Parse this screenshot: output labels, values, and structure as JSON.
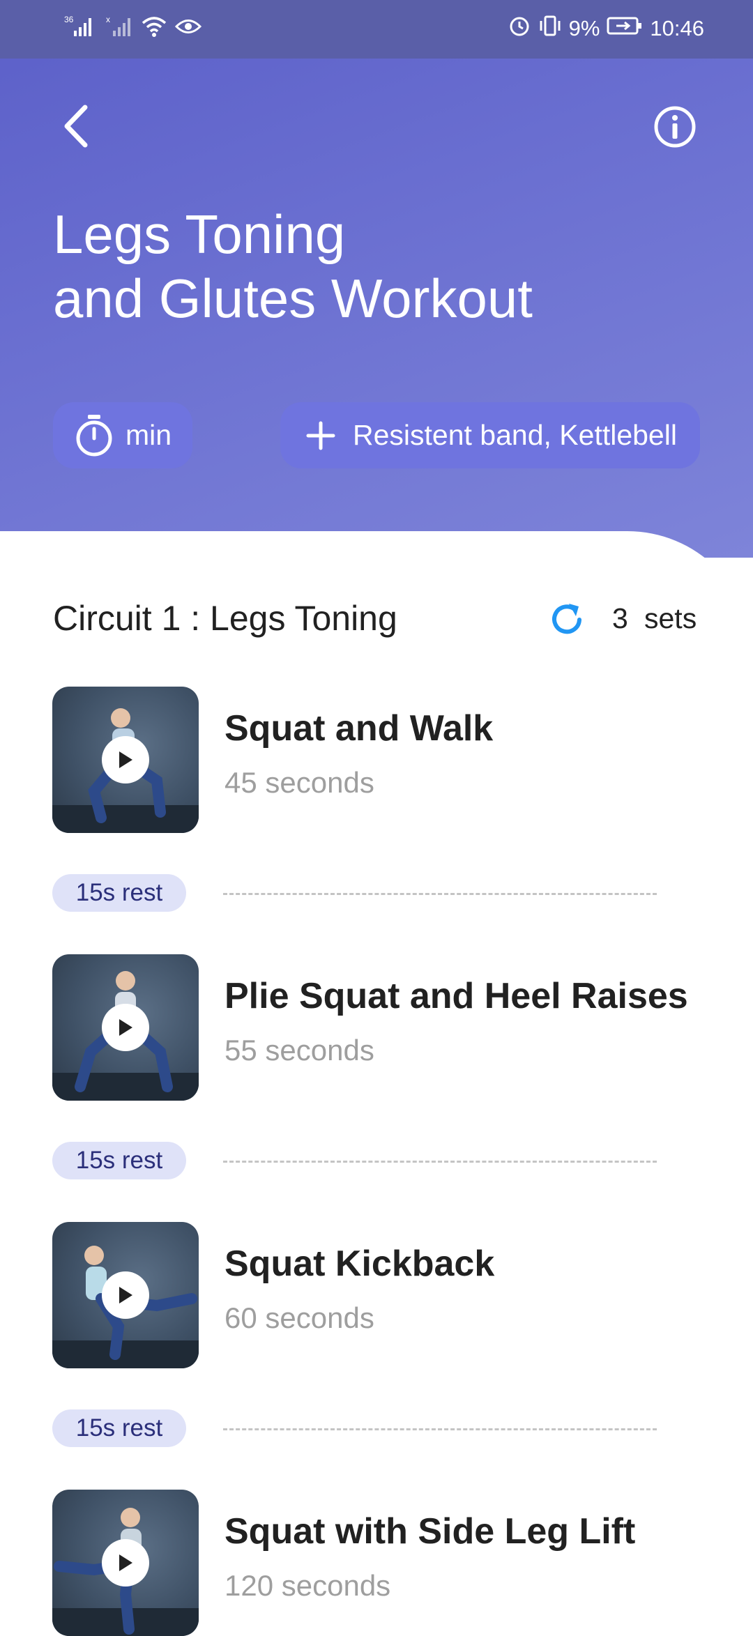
{
  "status_bar": {
    "network_left": "36",
    "battery_percent": "9%",
    "time": "10:46"
  },
  "header": {
    "title": "Legs Toning\nand Glutes Workout",
    "duration_label": "min",
    "equipment_label": "Resistent band, Kettlebell",
    "icons": [
      "back-icon",
      "info-icon",
      "timer-icon",
      "plus-icon"
    ]
  },
  "circuit": {
    "title": "Circuit 1 : Legs Toning",
    "sets_count": "3",
    "sets_label": "sets",
    "repeat_icon_color": "#2196f3"
  },
  "exercises": [
    {
      "name": "Squat and Walk",
      "duration": "45 seconds"
    },
    {
      "name": "Plie Squat and Heel Raises",
      "duration": "55 seconds"
    },
    {
      "name": "Squat Kickback",
      "duration": "60 seconds"
    },
    {
      "name": "Squat with Side Leg Lift",
      "duration": "120 seconds"
    }
  ],
  "rests": [
    {
      "label": "15s rest"
    },
    {
      "label": "15s rest"
    },
    {
      "label": "15s rest"
    }
  ],
  "colors": {
    "header_gradient_start": "#5b5fc8",
    "header_gradient_end": "#7e84d9",
    "rest_badge_bg": "#dfe2f8",
    "rest_badge_text": "#2b2f7a"
  }
}
